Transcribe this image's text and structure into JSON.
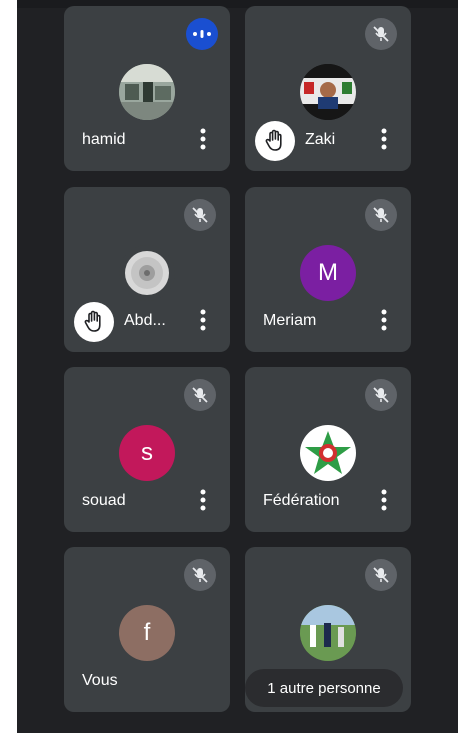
{
  "participants": [
    {
      "name": "hamid",
      "avatar_icon": "photo-avatar-icon",
      "status": "speaking",
      "hand_raised": false
    },
    {
      "name": "Zaki",
      "avatar_icon": "photo-avatar-icon",
      "status": "muted",
      "hand_raised": true
    },
    {
      "name": "Abd...",
      "avatar_icon": "dandelion-photo-icon",
      "status": "muted",
      "hand_raised": true
    },
    {
      "name": "Meriam",
      "avatar_initial": "M",
      "avatar_color": "#7b1fa2",
      "status": "muted",
      "hand_raised": false
    },
    {
      "name": "souad",
      "avatar_initial": "s",
      "avatar_color": "#c2185b",
      "status": "muted",
      "hand_raised": false
    },
    {
      "name": "Fédération",
      "avatar_icon": "federation-logo-icon",
      "status": "muted",
      "hand_raised": false
    },
    {
      "name": "Vous",
      "avatar_initial": "f",
      "avatar_color": "#8d6e63",
      "status": "muted",
      "hand_raised": false
    },
    {
      "avatar_icon": "photo-avatar-icon",
      "status": "muted",
      "hand_raised": false
    }
  ],
  "overflow_label": "1 autre personne",
  "colors": {
    "background": "#202124",
    "tile": "#3c4043",
    "speaking_badge": "#1a4fd1",
    "mute_badge": "#5f6368"
  }
}
